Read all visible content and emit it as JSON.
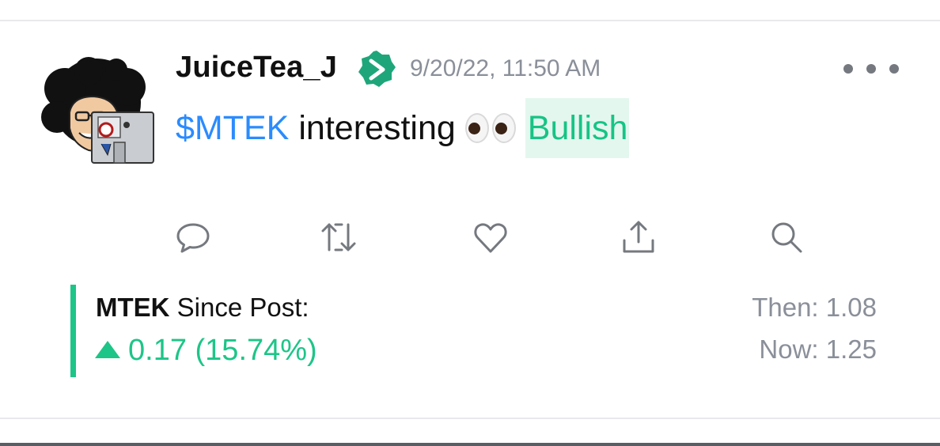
{
  "post": {
    "username": "JuiceTea_J",
    "timestamp": "9/20/22, 11:50 AM",
    "cashtag": "$MTEK",
    "text": "interesting",
    "emoji": "eyes",
    "sentiment": "Bullish"
  },
  "since_post": {
    "ticker": "MTEK",
    "label": "Since Post:",
    "change": "0.17 (15.74%)",
    "then": "Then: 1.08",
    "now": "Now: 1.25"
  },
  "colors": {
    "cashtag": "#2a8bff",
    "bullish": "#16c486",
    "bullish_bg": "#e4f7ef",
    "muted": "#8a8f99",
    "icon": "#75797f"
  },
  "icons": [
    "verified-badge-icon",
    "more-icon",
    "comment-icon",
    "reshare-icon",
    "like-icon",
    "share-icon",
    "search-icon"
  ]
}
